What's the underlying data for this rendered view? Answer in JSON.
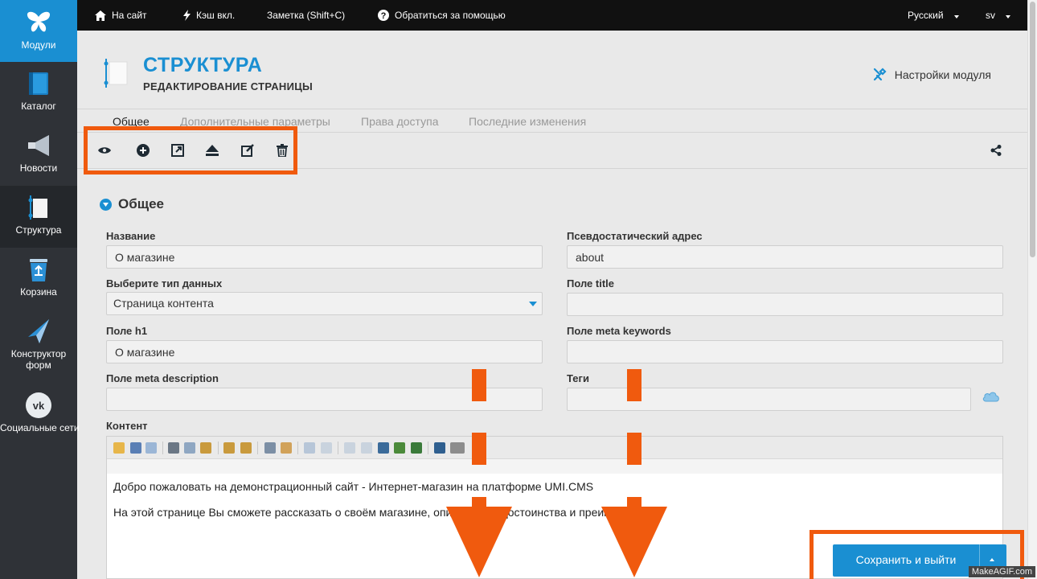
{
  "sidebar": {
    "items": [
      {
        "label": "Модули",
        "icon": "butterfly-icon"
      },
      {
        "label": "Каталог",
        "icon": "book-icon"
      },
      {
        "label": "Новости",
        "icon": "megaphone-icon"
      },
      {
        "label": "Структура",
        "icon": "structure-icon"
      },
      {
        "label": "Корзина",
        "icon": "recycle-bin-icon"
      },
      {
        "label": "Конструктор форм",
        "icon": "paper-plane-icon"
      },
      {
        "label": "Социальные сети",
        "icon": "vk-icon"
      }
    ]
  },
  "topbar": {
    "site_link": "На сайт",
    "cache": "Кэш вкл.",
    "note": "Заметка (Shift+C)",
    "help": "Обратиться за помощью",
    "language": "Русский",
    "user": "sv"
  },
  "header": {
    "title": "СТРУКТУРА",
    "subtitle": "РЕДАКТИРОВАНИЕ СТРАНИЦЫ",
    "module_settings": "Настройки модуля"
  },
  "tabs": [
    "Общее",
    "Дополнительные параметры",
    "Права доступа",
    "Последние изменения"
  ],
  "section": {
    "title": "Общее"
  },
  "fields": {
    "name_label": "Название",
    "name_value": "О магазине",
    "alt_label": "Псевдостатический адрес",
    "alt_value": "about",
    "type_label": "Выберите тип данных",
    "type_value": "Страница контента",
    "title_label": "Поле title",
    "title_value": "",
    "h1_label": "Поле h1",
    "h1_value": "О магазине",
    "keywords_label": "Поле meta keywords",
    "keywords_value": "",
    "description_label": "Поле meta description",
    "description_value": "",
    "tags_label": "Теги",
    "tags_value": "",
    "content_label": "Контент"
  },
  "editor": {
    "line1": "Добро пожаловать на демонстрационный сайт - Интернет-магазин на платформе UMI.CMS",
    "line2": "На этой странице Вы сможете рассказать о своём магазине, опишите его достоинства и преимущества."
  },
  "save": {
    "label": "Сохранить и выйти"
  },
  "watermark": "MakeAGIF.com",
  "colors": {
    "accent": "#1a8fd2",
    "highlight": "#f05a0e",
    "sidebar": "#2f3237"
  }
}
